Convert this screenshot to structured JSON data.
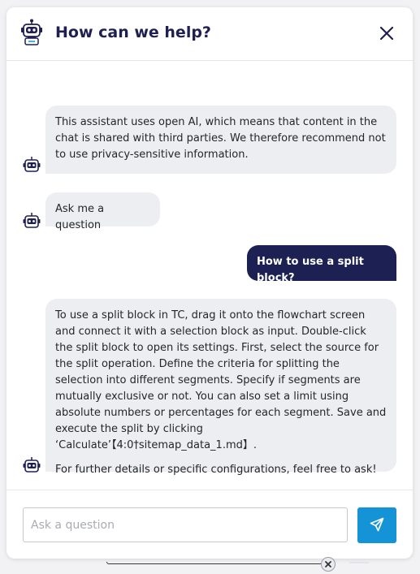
{
  "header": {
    "title": "How can we help?",
    "logo_icon": "robot-logo-icon",
    "close_icon": "close-icon"
  },
  "messages": [
    {
      "role": "assistant",
      "paragraphs": [
        "This assistant uses open AI, which means that content in the chat is shared with third parties. We therefore recommend not to use privacy-sensitive information."
      ]
    },
    {
      "role": "assistant",
      "paragraphs": [
        "Ask me a question"
      ]
    },
    {
      "role": "user",
      "text": "How to use a split block?"
    },
    {
      "role": "assistant",
      "paragraphs": [
        "To use a split block in TC, drag it onto the flowchart screen and connect it with a selection block as input. Double-click the split block to open its settings. First, select the source for the split operation. Define the criteria for splitting the selection into different segments. Specify if segments are mutually exclusive or not. You can also set a limit using absolute numbers or percentages for each segment. Save and execute the split by clicking ‘Calculate’【4:0†sitemap_data_1.md】.",
        "For further details or specific configurations, feel free to ask!"
      ]
    }
  ],
  "composer": {
    "placeholder": "Ask a question",
    "value": "",
    "send_icon": "send-icon"
  },
  "colors": {
    "accent": "#1493d6",
    "user_bubble": "#1d2052",
    "assistant_bubble": "#eceef1",
    "title": "#1f2050"
  }
}
